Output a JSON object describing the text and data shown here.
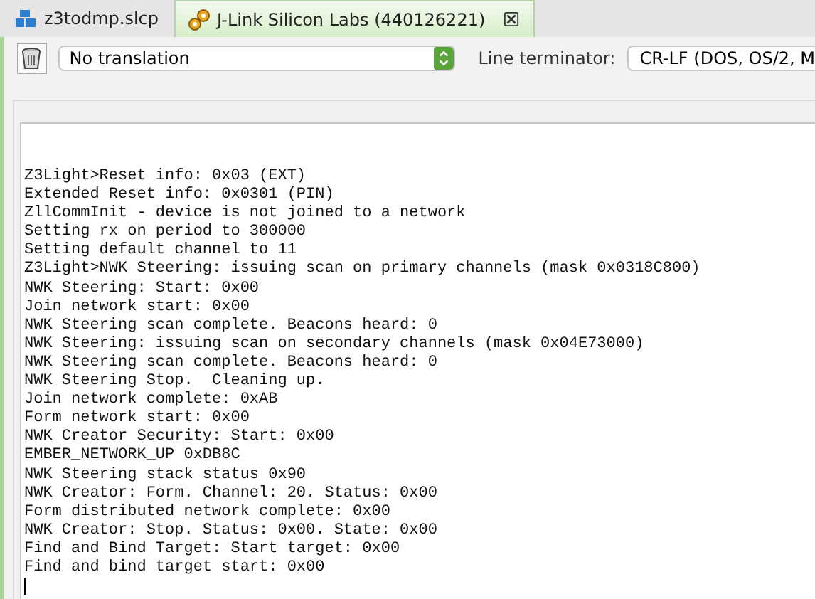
{
  "tabs": [
    {
      "label": "z3todmp.slcp",
      "selected": false,
      "closable": false
    },
    {
      "label": "J-Link Silicon Labs (440126221)",
      "selected": true,
      "closable": true
    }
  ],
  "toolbar": {
    "translation": "No translation",
    "terminator_label": "Line terminator:",
    "terminator": "CR-LF  (DOS, OS/2, M"
  },
  "console": {
    "lines": [
      "Z3Light>Reset info: 0x03 (EXT)",
      "Extended Reset info: 0x0301 (PIN)",
      "ZllCommInit - device is not joined to a network",
      "Setting rx on period to 300000",
      "Setting default channel to 11",
      "Z3Light>NWK Steering: issuing scan on primary channels (mask 0x0318C800)",
      "NWK Steering: Start: 0x00",
      "Join network start: 0x00",
      "NWK Steering scan complete. Beacons heard: 0",
      "NWK Steering: issuing scan on secondary channels (mask 0x04E73000)",
      "NWK Steering scan complete. Beacons heard: 0",
      "NWK Steering Stop.  Cleaning up.",
      "Join network complete: 0xAB",
      "Form network start: 0x00",
      "NWK Creator Security: Start: 0x00",
      "EMBER_NETWORK_UP 0xDB8C",
      "NWK Steering stack status 0x90",
      "NWK Creator: Form. Channel: 20. Status: 0x00",
      "Form distributed network complete: 0x00",
      "NWK Creator: Stop. Status: 0x00. State: 0x00",
      "Find and Bind Target: Start target: 0x00",
      "Find and bind target start: 0x00"
    ]
  }
}
